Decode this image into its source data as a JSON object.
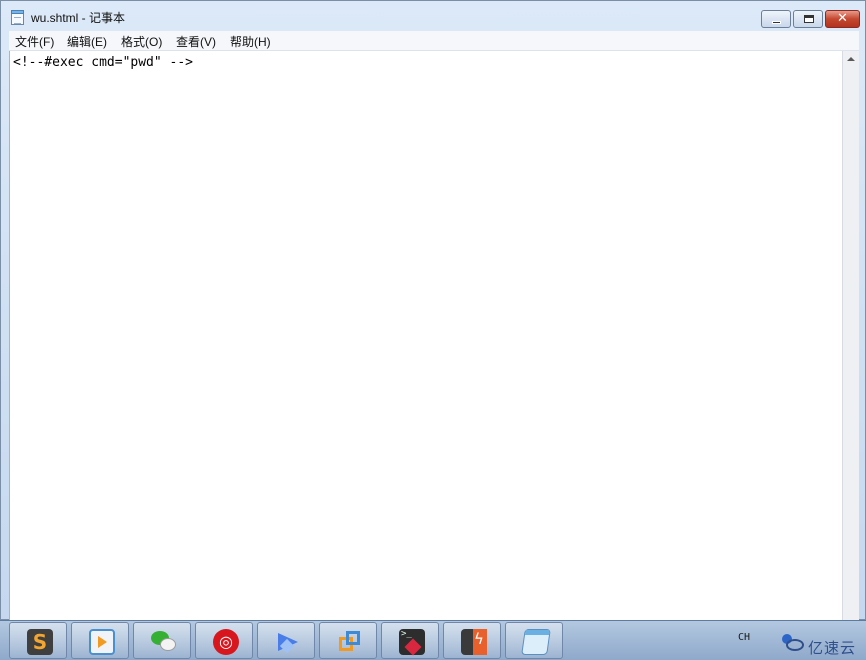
{
  "window": {
    "title": "wu.shtml - 记事本"
  },
  "menubar": {
    "items": [
      {
        "label": "文件(F)"
      },
      {
        "label": "编辑(E)"
      },
      {
        "label": "格式(O)"
      },
      {
        "label": "查看(V)"
      },
      {
        "label": "帮助(H)"
      }
    ]
  },
  "editor": {
    "content": "<!--#exec cmd=\"pwd\" -->"
  },
  "taskbar": {
    "apps": [
      {
        "icon": "sublime-text-icon"
      },
      {
        "icon": "media-player-icon"
      },
      {
        "icon": "wechat-icon"
      },
      {
        "icon": "netease-music-icon"
      },
      {
        "icon": "feige-bird-icon"
      },
      {
        "icon": "vmware-icon"
      },
      {
        "icon": "terminal-icon"
      },
      {
        "icon": "burp-suite-icon"
      },
      {
        "icon": "notepad-icon"
      }
    ],
    "tray": {
      "language": "CH"
    },
    "watermark": "亿速云"
  },
  "colors": {
    "titlebar": "#dce9f8",
    "close_button": "#c4472f",
    "editor_bg": "#ffffff",
    "taskbar": "#a3bbd8"
  }
}
